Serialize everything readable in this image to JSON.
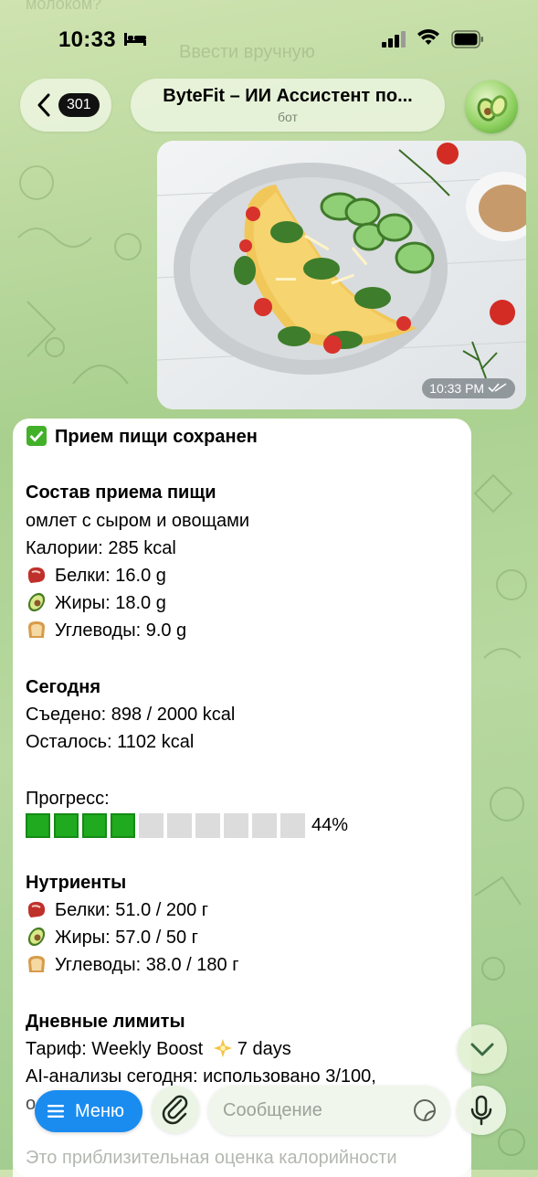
{
  "status_bar": {
    "time": "10:33"
  },
  "ghost_bg": {
    "top_text": "молоком?",
    "manual_text": "Ввести вручную"
  },
  "header": {
    "back_count": "301",
    "title": "ByteFit – ИИ Ассистент по...",
    "subtitle": "бот"
  },
  "photo": {
    "timestamp": "10:33 PM"
  },
  "message": {
    "saved": "Прием пищи сохранен",
    "composition_heading": "Состав приема пищи",
    "dish": "омлет с сыром и овощами",
    "calories": "Калории: 285 kcal",
    "protein": "Белки: 16.0 g",
    "fat": "Жиры: 18.0 g",
    "carbs": "Углеводы: 9.0 g",
    "today_heading": "Сегодня",
    "eaten": "Съедено: 898 / 2000 kcal",
    "left": "Осталось: 1102 kcal",
    "progress_label": "Прогресс:",
    "progress_percent": "44%",
    "progress_filled": 4,
    "progress_total": 10,
    "nutrients_heading": "Нутриенты",
    "n_protein": "Белки: 51.0 / 200 г",
    "n_fat": "Жиры: 57.0 / 50 г",
    "n_carbs": "Углеводы: 38.0 / 180 г",
    "limits_heading": "Дневные лимиты",
    "tariff_pre": "Тариф: Weekly Boost",
    "tariff_post": "7 days",
    "ai_usage": "AI-анализы сегодня: использовано 3/100,",
    "ai_usage_cont": "о",
    "disclaimer": "Это приблизительная оценка калорийности"
  },
  "composer": {
    "menu_label": "Меню",
    "placeholder": "Сообщение"
  },
  "colors": {
    "accent": "#1a8cf0",
    "progress_fill": "#1faa1f",
    "progress_empty": "#dcdcdc"
  }
}
